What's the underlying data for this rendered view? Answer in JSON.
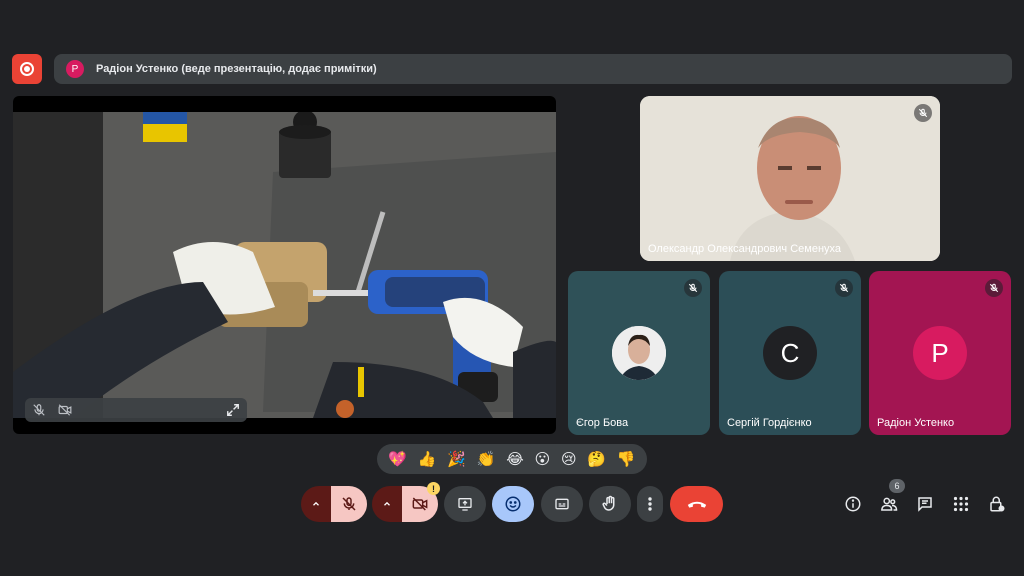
{
  "top_bar": {
    "presenter_avatar_letter": "Р",
    "presenter_text": "Радіон Устенко (веде презентацію, додає примітки)"
  },
  "tiles": [
    {
      "name": "Олександр Олександрович Семенуха",
      "type": "video"
    },
    {
      "name": "Єгор Бова",
      "type": "photo"
    },
    {
      "name": "Сергій Гордієнко",
      "type": "initial",
      "letter": "С",
      "bg": "#2c4e57",
      "avatar_bg": "#202124"
    },
    {
      "name": "Радіон Устенко",
      "type": "initial",
      "letter": "Р",
      "bg": "#a31552",
      "avatar_bg": "#d81b60"
    }
  ],
  "reactions": [
    "💖",
    "👍",
    "🎉",
    "👏",
    "😂",
    "😮",
    "😢",
    "🤔",
    "👎"
  ],
  "people_count": "6",
  "camera_warning": "!",
  "colors": {
    "background": "#202124",
    "bar": "#3c4043",
    "record": "#ea4335",
    "end_call": "#ea4335",
    "emoji_active": "#a8c7fa"
  },
  "icons": [
    "record-icon",
    "mic-off-icon",
    "camera-off-icon",
    "fullscreen-icon",
    "present-icon",
    "emoji-icon",
    "captions-icon",
    "raise-hand-icon",
    "more-icon",
    "end-call-icon",
    "info-icon",
    "people-icon",
    "chat-icon",
    "activities-icon",
    "host-controls-icon"
  ]
}
